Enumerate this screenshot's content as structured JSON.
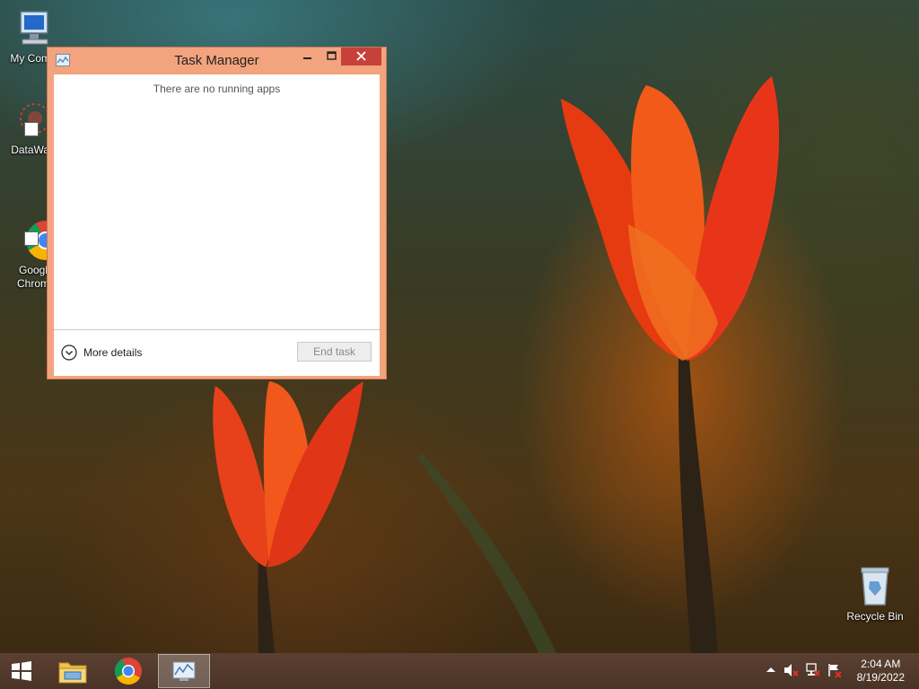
{
  "desktop": {
    "icons": [
      {
        "label": "My Comp"
      },
      {
        "label": "DataWag"
      },
      {
        "label": "Googl\nChrom"
      },
      {
        "label": "Recycle Bin"
      }
    ]
  },
  "task_manager": {
    "title": "Task Manager",
    "empty_message": "There are no running apps",
    "more_details_label": "More details",
    "end_task_label": "End task",
    "caption_buttons": {
      "minimize": "–",
      "maximize": "□",
      "close": "✕"
    }
  },
  "taskbar": {
    "items": [
      {
        "name": "start-button",
        "icon": "windows-logo-icon"
      },
      {
        "name": "file-explorer",
        "icon": "folder-icon"
      },
      {
        "name": "google-chrome",
        "icon": "chrome-icon"
      },
      {
        "name": "task-manager",
        "icon": "task-manager-icon",
        "active": true
      }
    ],
    "tray": {
      "icons": [
        "show-hidden-icons-icon",
        "speaker-muted-icon",
        "network-icon",
        "action-center-flag-icon"
      ],
      "time": "2:04 AM",
      "date": "8/19/2022"
    }
  },
  "colors": {
    "window_frame": "#f3a37d",
    "close_button": "#c7413a",
    "taskbar": "#4f372a"
  }
}
